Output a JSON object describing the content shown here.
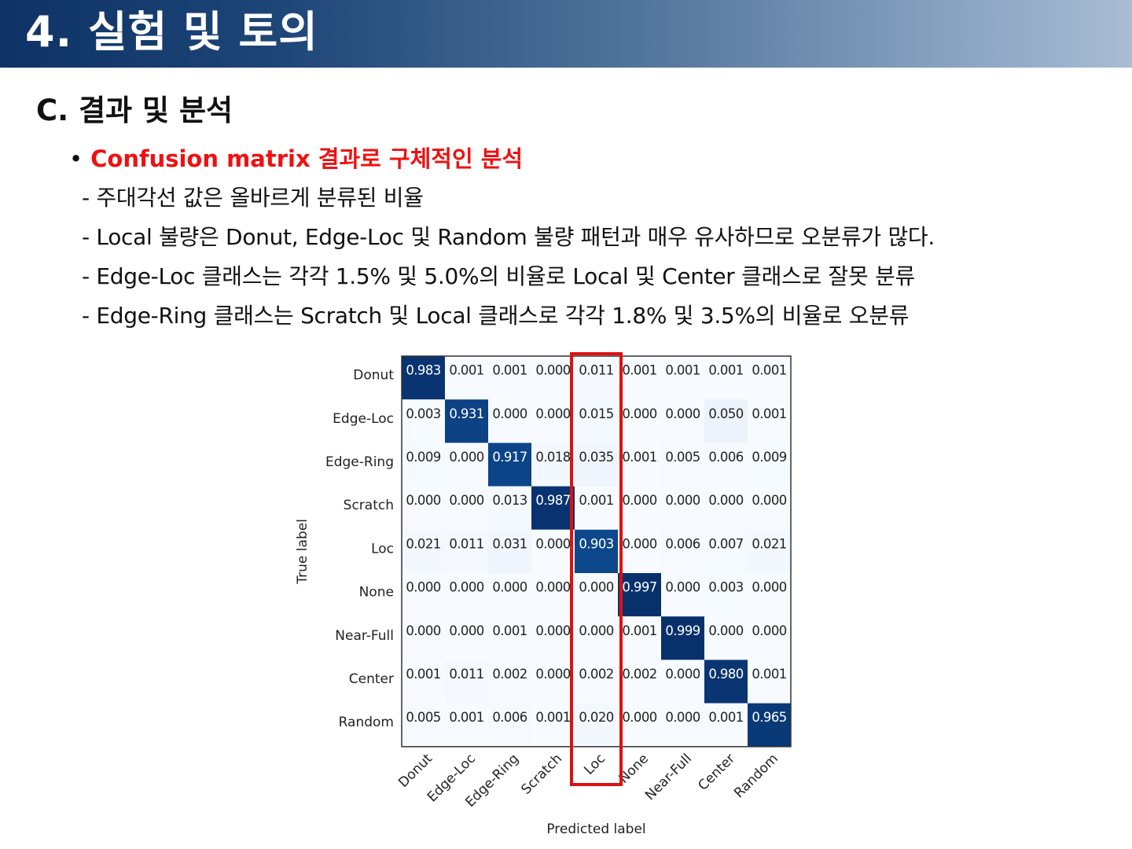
{
  "header": {
    "title": "4. 실험 및 토의"
  },
  "section": {
    "heading": "C.  결과 및 분석"
  },
  "bullet": {
    "symbol": "•",
    "text": "Confusion matrix 결과로 구체적인 분석"
  },
  "lines": [
    "- 주대각선 값은 올바르게 분류된 비율",
    "- Local 불량은 Donut, Edge-Loc 및 Random 불량 패턴과 매우 유사하므로 오분류가 많다.",
    "- Edge-Loc 클래스는 각각 1.5% 및 5.0%의 비율로 Local 및 Center 클래스로 잘못 분류",
    "- Edge-Ring 클래스는 Scratch 및 Local 클래스로 각각 1.8% 및 3.5%의 비율로 오분류"
  ],
  "colors": {
    "accent_red": "#ee1111",
    "highlight_box": "#e01010",
    "cell_high": "#08306b",
    "cell_low": "#f7fbff"
  },
  "chart_data": {
    "type": "heatmap",
    "xlabel": "Predicted label",
    "ylabel": "True label",
    "x_categories": [
      "Donut",
      "Edge-Loc",
      "Edge-Ring",
      "Scratch",
      "Loc",
      "None",
      "Near-Full",
      "Center",
      "Random"
    ],
    "y_categories": [
      "Donut",
      "Edge-Loc",
      "Edge-Ring",
      "Scratch",
      "Loc",
      "None",
      "Near-Full",
      "Center",
      "Random"
    ],
    "values": [
      [
        0.983,
        0.001,
        0.001,
        0.0,
        0.011,
        0.001,
        0.001,
        0.001,
        0.001
      ],
      [
        0.003,
        0.931,
        0.0,
        0.0,
        0.015,
        0.0,
        0.0,
        0.05,
        0.001
      ],
      [
        0.009,
        0.0,
        0.917,
        0.018,
        0.035,
        0.001,
        0.005,
        0.006,
        0.009
      ],
      [
        0.0,
        0.0,
        0.013,
        0.987,
        0.001,
        0.0,
        0.0,
        0.0,
        0.0
      ],
      [
        0.021,
        0.011,
        0.031,
        0.0,
        0.903,
        0.0,
        0.006,
        0.007,
        0.021
      ],
      [
        0.0,
        0.0,
        0.0,
        0.0,
        0.0,
        0.997,
        0.0,
        0.003,
        0.0
      ],
      [
        0.0,
        0.0,
        0.001,
        0.0,
        0.0,
        0.001,
        0.999,
        0.0,
        0.0
      ],
      [
        0.001,
        0.011,
        0.002,
        0.0,
        0.002,
        0.002,
        0.0,
        0.98,
        0.001
      ],
      [
        0.005,
        0.001,
        0.006,
        0.001,
        0.02,
        0.0,
        0.0,
        0.001,
        0.965
      ]
    ],
    "value_range": [
      0,
      1
    ],
    "colormap": "Blues",
    "highlight_column": "Loc"
  }
}
